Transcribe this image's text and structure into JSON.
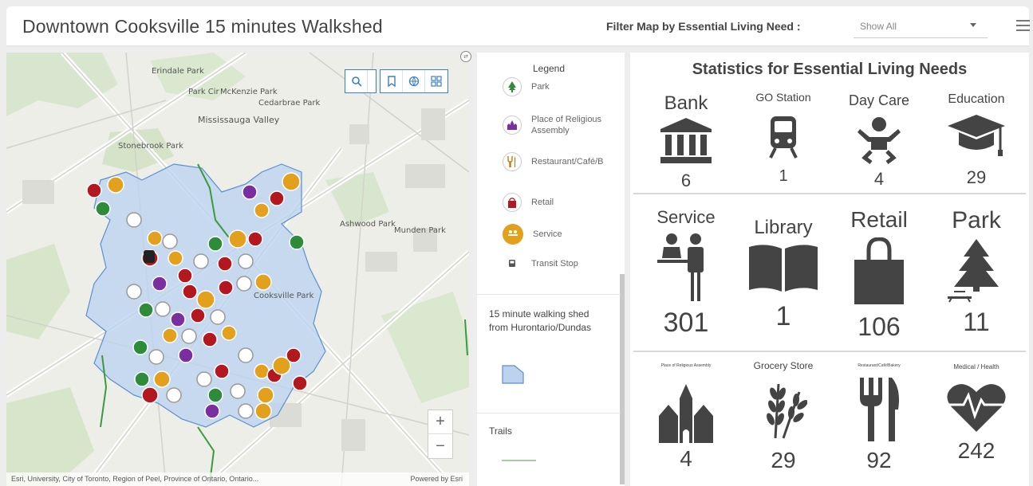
{
  "header": {
    "title": "Downtown Cooksville 15 minutes Walkshed",
    "filter_label": "Filter Map by Essential Living Need :",
    "filter_value": "Show All"
  },
  "map": {
    "place_labels": [
      "Erindale Park",
      "Park Cir",
      "McKenzie Park",
      "Cedarbrae Park",
      "Mississauga Valley",
      "Stonebrook Park",
      "Ashwood Park",
      "Munden Park",
      "Cooksville Park"
    ],
    "attribution": "Esri, University, City of Toronto, Region of Peel, Province of Ontario, Ontario...",
    "powered_by": "Powered by Esri",
    "zoom_in": "+",
    "zoom_out": "−"
  },
  "legend": {
    "title": "Legend",
    "items": [
      {
        "label": "Park",
        "icon": "tree-icon",
        "color": "#2e8b3a"
      },
      {
        "label": "Place of Religious Assembly",
        "icon": "church-icon",
        "color": "#7a2ea0"
      },
      {
        "label": "Restaurant/Café/B",
        "icon": "fork-knife-icon",
        "color": "#c07a10"
      },
      {
        "label": "Retail",
        "icon": "bag-icon",
        "color": "#b3181f"
      },
      {
        "label": "Service",
        "icon": "service-icon",
        "color": "#e2a01d"
      },
      {
        "label": "Transit Stop",
        "icon": "bus-icon",
        "color": "#555555"
      }
    ],
    "walkshed_label": "15 minute walking shed from Hurontario/Dundas",
    "trails_label": "Trails"
  },
  "stats": {
    "title": "Statistics for Essential Living Needs",
    "row1": [
      {
        "label": "Bank",
        "value": "6",
        "icon": "bank-icon"
      },
      {
        "label": "GO Station",
        "value": "1",
        "icon": "train-icon"
      },
      {
        "label": "Day Care",
        "value": "4",
        "icon": "baby-icon"
      },
      {
        "label": "Education",
        "value": "29",
        "icon": "graduation-cap-icon"
      }
    ],
    "row2": [
      {
        "label": "Service",
        "value": "301",
        "icon": "service-desk-icon"
      },
      {
        "label": "Library",
        "value": "1",
        "icon": "book-icon"
      },
      {
        "label": "Retail",
        "value": "106",
        "icon": "shopping-bag-icon"
      },
      {
        "label": "Park",
        "value": "11",
        "icon": "tree-icon"
      }
    ],
    "row3": [
      {
        "label": "Place of Religious Assembly",
        "value": "4",
        "icon": "church-icon"
      },
      {
        "label": "Grocery Store",
        "value": "29",
        "icon": "wheat-icon"
      },
      {
        "label": "Restaurant/Café/Bakery",
        "value": "92",
        "icon": "fork-knife-icon"
      },
      {
        "label": "Medical / Health",
        "value": "242",
        "icon": "heartbeat-icon"
      }
    ]
  }
}
